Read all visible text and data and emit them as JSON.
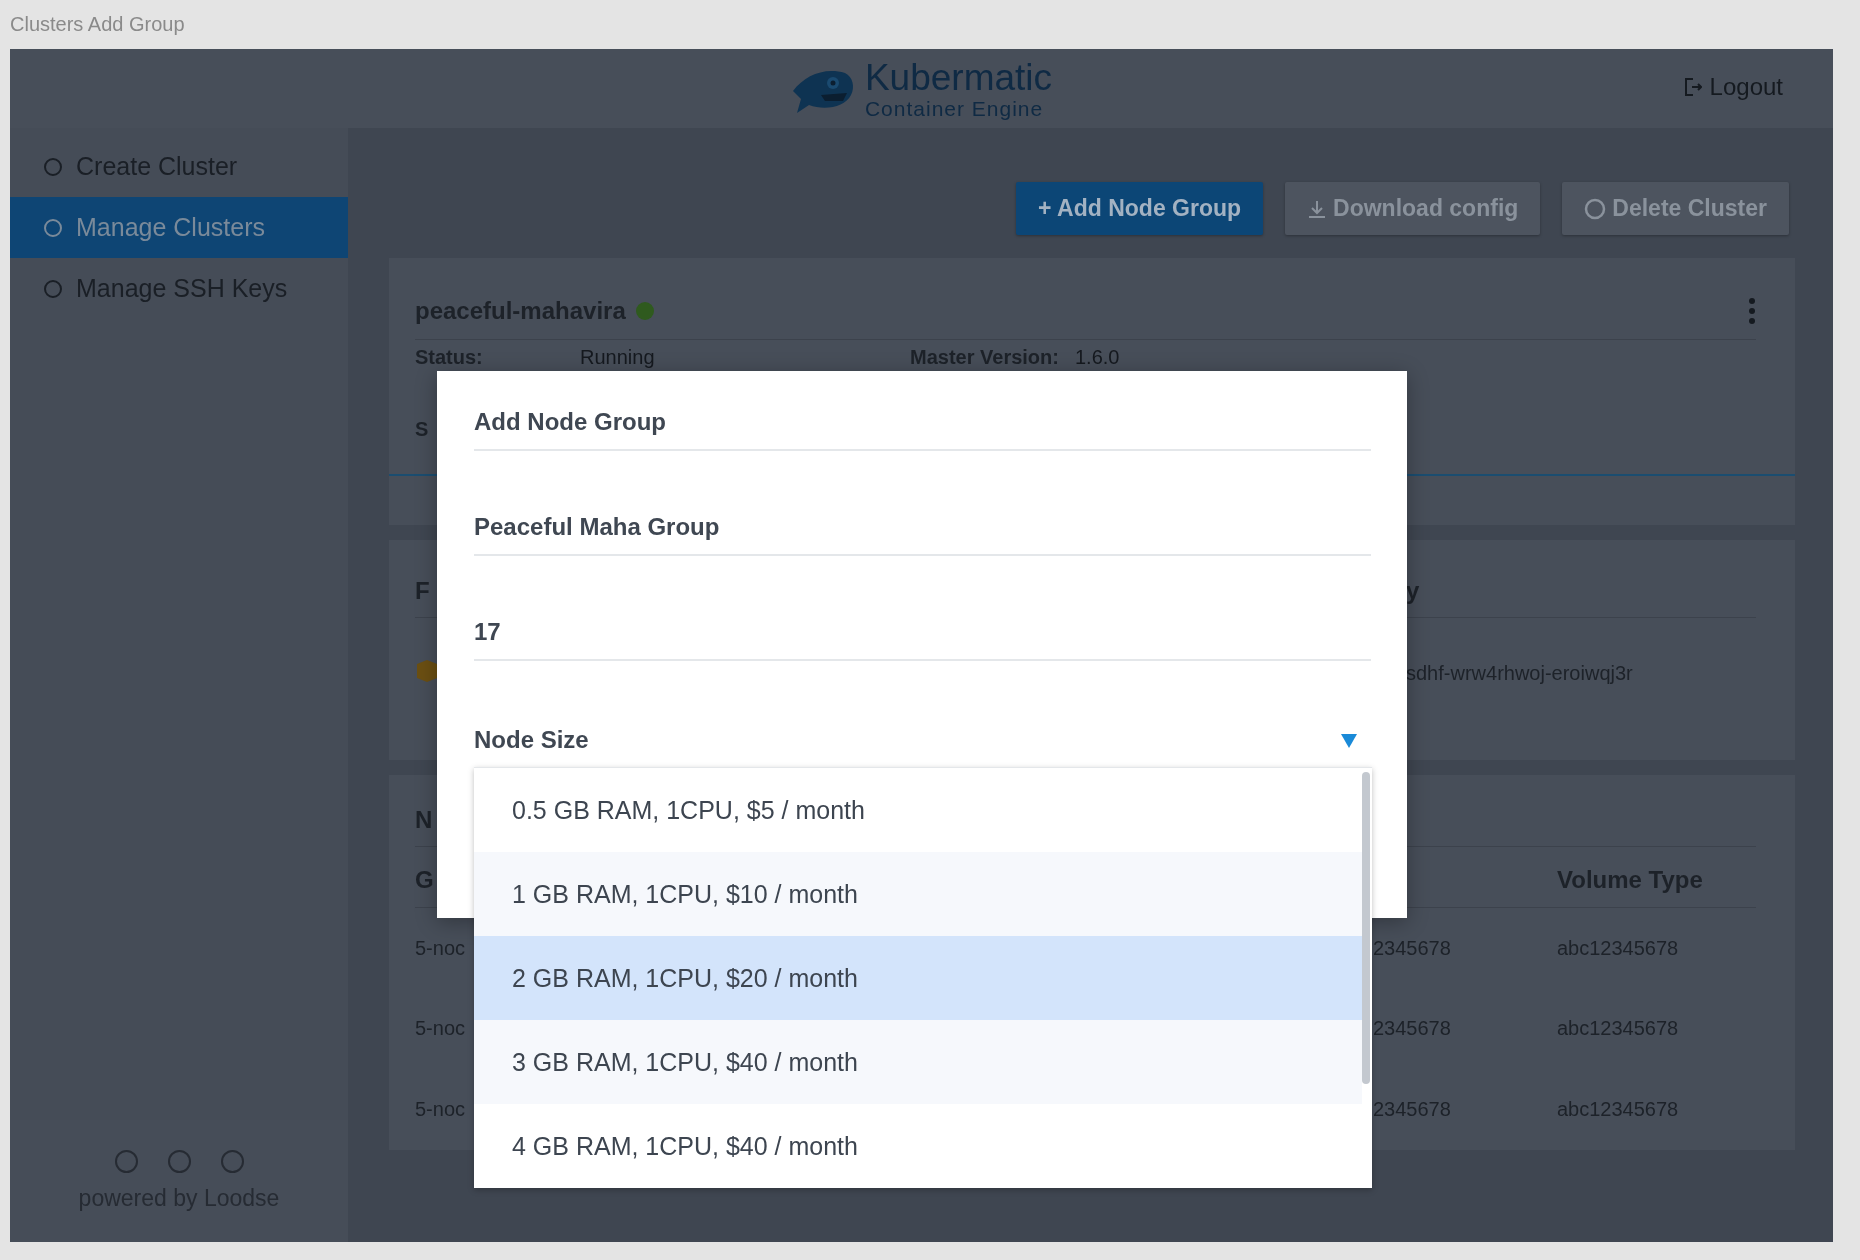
{
  "caption": "Clusters Add Group",
  "header": {
    "logo_title": "Kubermatic",
    "logo_subtitle": "Container Engine",
    "logout": "Logout"
  },
  "sidebar": {
    "items": [
      {
        "label": "Create Cluster",
        "selected": false
      },
      {
        "label": "Manage Clusters",
        "selected": true
      },
      {
        "label": "Manage SSH Keys",
        "selected": false
      }
    ],
    "footer": "powered by Loodse"
  },
  "toolbar": {
    "buttons": [
      {
        "label": "+ Add Node Group",
        "kind": "plain",
        "disabled": false
      },
      {
        "label": "Download config",
        "kind": "download",
        "disabled": true
      },
      {
        "label": "Delete Cluster",
        "kind": "delete",
        "disabled": true
      }
    ]
  },
  "cluster_card": {
    "name": "peaceful-mahavira",
    "fields": [
      {
        "label": "Status:",
        "value": "Running"
      },
      {
        "label": "Master Version:",
        "value": "1.6.0"
      }
    ],
    "row_2_label": "S"
  },
  "card_2": {
    "heading_left": "F",
    "heading_right": "y",
    "value_right": "sdhf-wrw4rhwoj-eroiwqj3r"
  },
  "node_groups": {
    "title": "N",
    "columns": {
      "column_1": "G",
      "column_4": "Volume Type"
    },
    "rows": [
      {
        "column_1": "5-noc",
        "column_3": "2345678",
        "column_4": "abc12345678"
      },
      {
        "column_1": "5-noc",
        "column_3": "2345678",
        "column_4": "abc12345678"
      },
      {
        "column_1": "5-noc",
        "column_3": "2345678",
        "column_4": "abc12345678"
      }
    ]
  },
  "modal": {
    "title": "Add Node Group",
    "name_value": "Peaceful Maha Group",
    "count_value": "17",
    "node_size": {
      "label": "Node Size",
      "expanded": true,
      "options": [
        {
          "label": "0.5 GB RAM, 1CPU, $5 / month",
          "selected": false
        },
        {
          "label": "1 GB RAM, 1CPU, $10 / month",
          "selected": false
        },
        {
          "label": "2 GB RAM, 1CPU, $20 / month",
          "selected": true
        },
        {
          "label": "3 GB RAM, 1CPU, $40 / month",
          "selected": false
        },
        {
          "label": "4 GB RAM, 1CPU, $40 / month",
          "selected": false
        }
      ]
    }
  }
}
